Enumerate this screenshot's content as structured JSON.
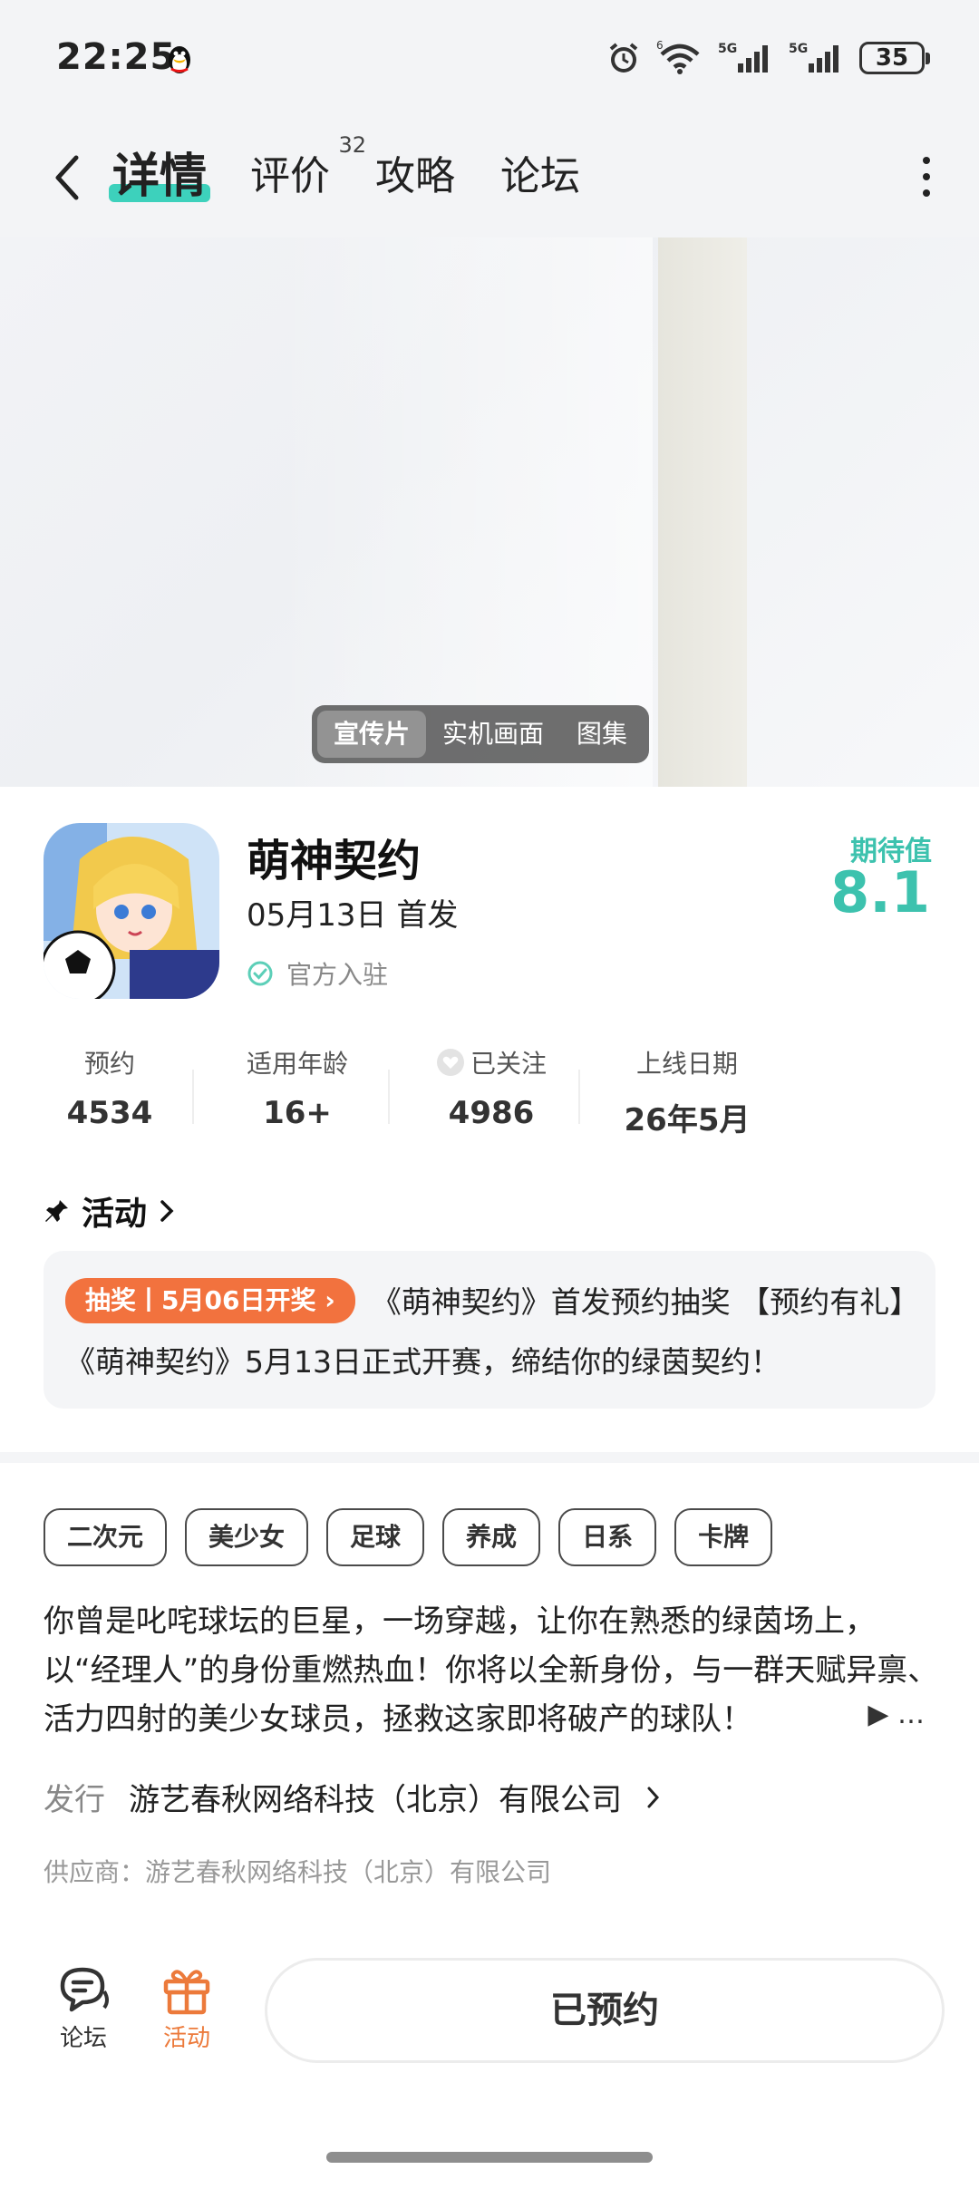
{
  "status": {
    "time": "22:25",
    "battery": "35",
    "signal1": "5G",
    "signal2": "5G",
    "wifi_label": "6"
  },
  "nav": {
    "tabs": [
      {
        "label": "详情",
        "active": true
      },
      {
        "label": "评价",
        "badge": "32"
      },
      {
        "label": "攻略"
      },
      {
        "label": "论坛"
      }
    ]
  },
  "media": {
    "tabs": [
      "宣传片",
      "实机画面",
      "图集"
    ]
  },
  "game": {
    "title": "萌神契约",
    "release": "05月13日 首发",
    "official": "官方入驻",
    "expect_label": "期待值",
    "expect_score": "8.1"
  },
  "stats": [
    {
      "label": "预约",
      "value": "4534"
    },
    {
      "label": "适用年龄",
      "value": "16+"
    },
    {
      "label": "已关注",
      "value": "4986"
    },
    {
      "label": "上线日期",
      "value": "26年5月"
    }
  ],
  "activity": {
    "heading": "活动",
    "tag": "抽奖丨5月06日开奖",
    "text": "《萌神契约》首发预约抽奖 【预约有礼】《萌神契约》5月13日正式开赛，缔结你的绿茵契约！"
  },
  "tags": [
    "二次元",
    "美少女",
    "足球",
    "养成",
    "日系",
    "卡牌"
  ],
  "description": {
    "text": "你曾是叱咤球坛的巨星，一场穿越，让你在熟悉的绿茵场上，以“经理人”的身份重燃热血！你将以全新身份，与一群天赋异禀、活力四射的美少女球员，拯救这家即将破产的球队！",
    "more": "▶ …"
  },
  "publisher": {
    "label": "发行",
    "name": "游艺春秋网络科技（北京）有限公司"
  },
  "supplier": "供应商：游艺春秋网络科技（北京）有限公司",
  "bottom": {
    "forum_label": "论坛",
    "activity_label": "活动",
    "reserve_button": "已预约"
  },
  "colors": {
    "accent": "#3dc2ae",
    "orange": "#f2723e"
  }
}
